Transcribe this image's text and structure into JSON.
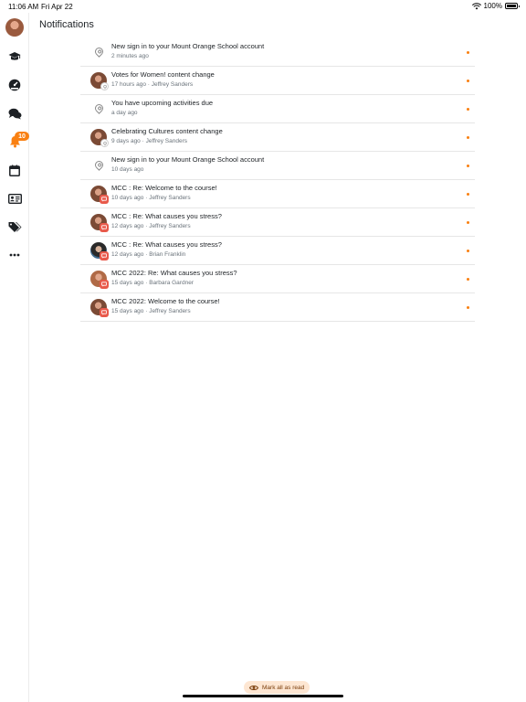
{
  "status_bar": {
    "time": "11:06 AM",
    "date": "Fri Apr 22",
    "battery": "100%"
  },
  "page": {
    "title": "Notifications"
  },
  "sidebar": {
    "items": [
      {
        "name": "user-avatar"
      },
      {
        "name": "graduation-cap-icon"
      },
      {
        "name": "dashboard-gauge-icon"
      },
      {
        "name": "messages-icon"
      },
      {
        "name": "bell-icon"
      },
      {
        "name": "calendar-icon"
      },
      {
        "name": "id-card-icon"
      },
      {
        "name": "tags-icon"
      },
      {
        "name": "more-icon"
      }
    ],
    "notification_count": "10"
  },
  "notifications": [
    {
      "title": "New sign in to your Mount Orange School account",
      "meta": "2 minutes ago",
      "icon": "pin",
      "unread": true
    },
    {
      "title": "Votes for Women! content change",
      "meta": "17 hours ago · Jeffrey Sanders",
      "icon": "avatar-js-gray",
      "unread": true
    },
    {
      "title": "You have upcoming activities due",
      "meta": "a day ago",
      "icon": "pin",
      "unread": true
    },
    {
      "title": "Celebrating Cultures content change",
      "meta": "9 days ago · Jeffrey Sanders",
      "icon": "avatar-js-gray",
      "unread": true
    },
    {
      "title": "New sign in to your Mount Orange School account",
      "meta": "10 days ago",
      "icon": "pin",
      "unread": true
    },
    {
      "title": "MCC : Re: Welcome to the course!",
      "meta": "10 days ago · Jeffrey Sanders",
      "icon": "avatar-js-forum",
      "unread": true
    },
    {
      "title": "MCC : Re: What causes you stress?",
      "meta": "12 days ago · Jeffrey Sanders",
      "icon": "avatar-js-forum",
      "unread": true
    },
    {
      "title": "MCC : Re: What causes you stress?",
      "meta": "12 days ago · Brian Franklin",
      "icon": "avatar-bf-forum",
      "unread": true
    },
    {
      "title": "MCC 2022: Re: What causes you stress?",
      "meta": "15 days ago · Barbara Gardner",
      "icon": "avatar-bg-forum",
      "unread": true
    },
    {
      "title": "MCC 2022: Welcome to the course!",
      "meta": "15 days ago · Jeffrey Sanders",
      "icon": "avatar-js-forum",
      "unread": true
    }
  ],
  "footer": {
    "mark_all_label": "Mark all as read"
  },
  "colors": {
    "accent": "#f98012",
    "forum_badge": "#e8594a",
    "mark_all_bg": "#fde6d2"
  }
}
